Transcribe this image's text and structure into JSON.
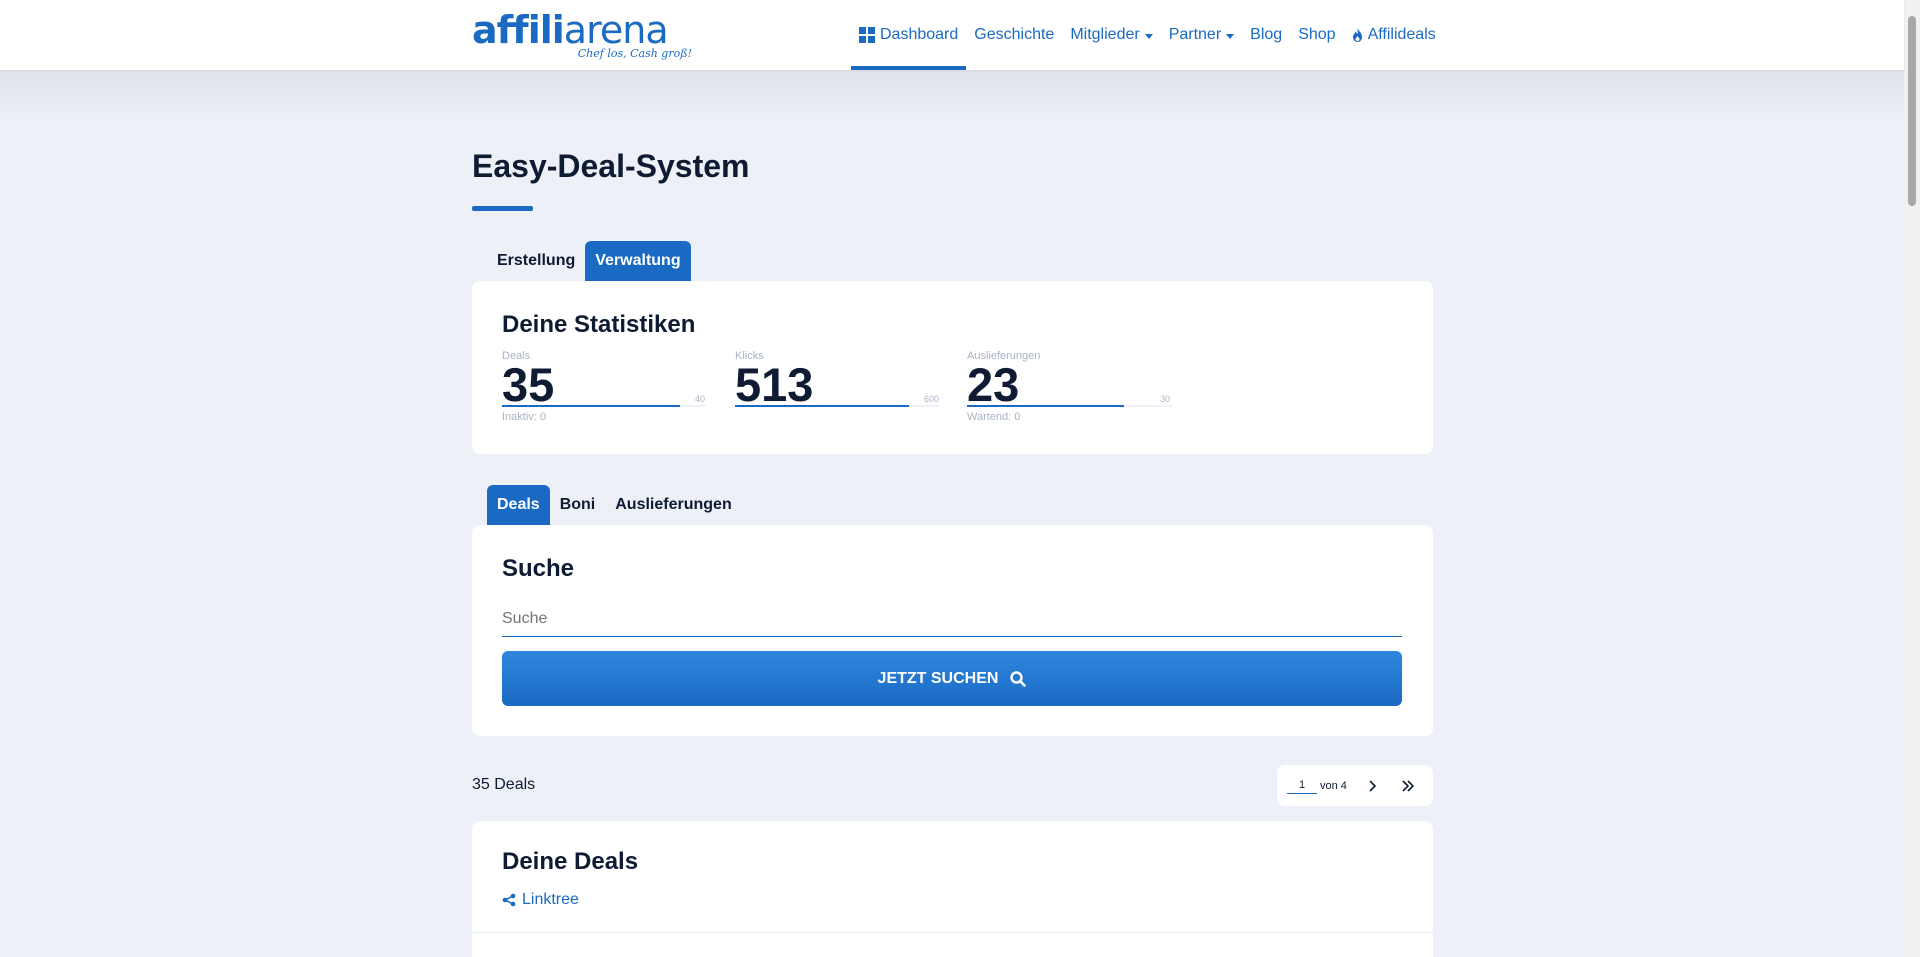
{
  "brand": {
    "logo_text_bold": "affili",
    "logo_text_light": "arena",
    "tagline": "Chef los, Cash groß!",
    "accent_color": "#1a6ac3"
  },
  "nav": {
    "dashboard": "Dashboard",
    "history": "Geschichte",
    "members": "Mitglieder",
    "partners": "Partner",
    "blog": "Blog",
    "shop": "Shop",
    "affilideals": "Affilideals"
  },
  "page": {
    "title": "Easy-Deal-System"
  },
  "main_tabs": {
    "create": "Erstellung",
    "manage": "Verwaltung"
  },
  "stats": {
    "title": "Deine Statistiken",
    "items": [
      {
        "label": "Deals",
        "value": "35",
        "max": "40",
        "sub": "Inaktiv: 0",
        "fraction": 0.875
      },
      {
        "label": "Klicks",
        "value": "513",
        "max": "600",
        "sub": "",
        "fraction": 0.855
      },
      {
        "label": "Auslieferungen",
        "value": "23",
        "max": "30",
        "sub": "Wartend: 0",
        "fraction": 0.767
      }
    ]
  },
  "sub_tabs": {
    "deals": "Deals",
    "bonuses": "Boni",
    "deliveries": "Auslieferungen"
  },
  "search": {
    "title": "Suche",
    "placeholder": "Suche",
    "button_label": "JETZT SUCHEN"
  },
  "results": {
    "count_label": "35 Deals",
    "page_current": "1",
    "page_of": "von 4"
  },
  "deals_card": {
    "title": "Deine Deals",
    "linktree": "Linktree"
  }
}
